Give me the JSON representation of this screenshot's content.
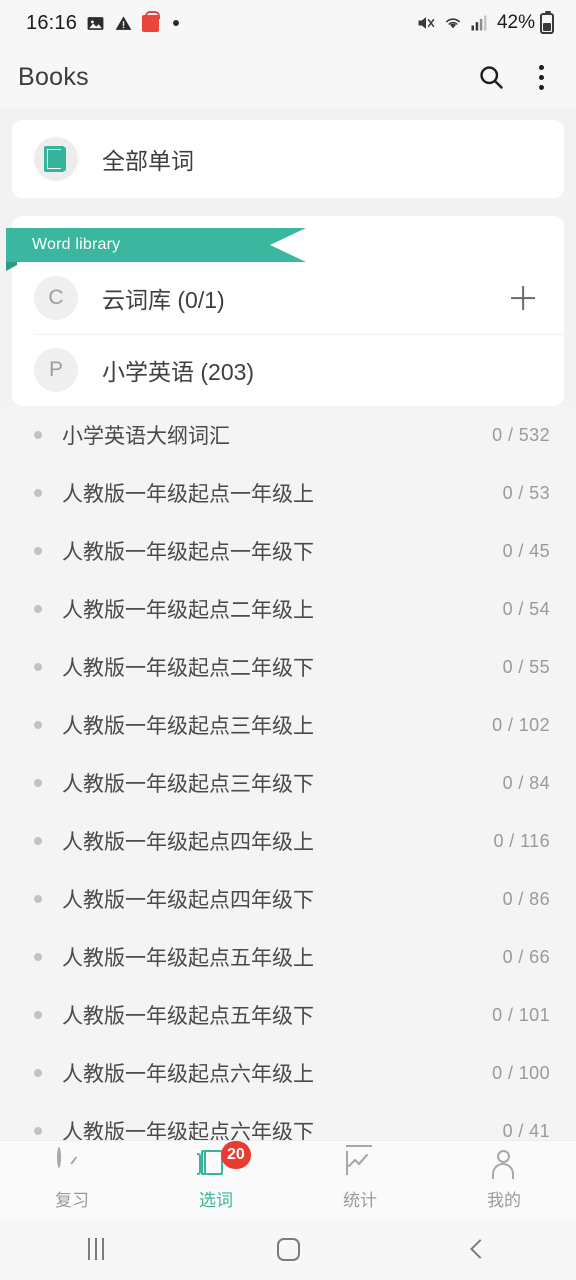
{
  "statusbar": {
    "time": "16:16",
    "battery_percent": "42%",
    "icons": [
      "image-icon",
      "warning-icon",
      "basket-icon",
      "dot-icon",
      "mute-icon",
      "wifi-icon",
      "signal-icon",
      "battery-icon"
    ]
  },
  "appbar": {
    "title": "Books",
    "search_label": "search-icon",
    "overflow_label": "more-options-icon"
  },
  "all_words_card": {
    "label": "全部单词",
    "icon": "book-icon"
  },
  "library": {
    "ribbon_label": "Word library",
    "rows": [
      {
        "initial": "C",
        "name": "云词库 (0/1)",
        "has_add": true
      },
      {
        "initial": "P",
        "name": "小学英语 (203)",
        "has_add": false
      }
    ]
  },
  "books": [
    {
      "title": "小学英语大纲词汇",
      "count": "0 / 532"
    },
    {
      "title": "人教版一年级起点一年级上",
      "count": "0 / 53"
    },
    {
      "title": "人教版一年级起点一年级下",
      "count": "0 / 45"
    },
    {
      "title": "人教版一年级起点二年级上",
      "count": "0 / 54"
    },
    {
      "title": "人教版一年级起点二年级下",
      "count": "0 / 55"
    },
    {
      "title": "人教版一年级起点三年级上",
      "count": "0 / 102"
    },
    {
      "title": "人教版一年级起点三年级下",
      "count": "0 / 84"
    },
    {
      "title": "人教版一年级起点四年级上",
      "count": "0 / 116"
    },
    {
      "title": "人教版一年级起点四年级下",
      "count": "0 / 86"
    },
    {
      "title": "人教版一年级起点五年级上",
      "count": "0 / 66"
    },
    {
      "title": "人教版一年级起点五年级下",
      "count": "0 / 101"
    },
    {
      "title": "人教版一年级起点六年级上",
      "count": "0 / 100"
    },
    {
      "title": "人教版一年级起点六年级下",
      "count": "0 / 41"
    }
  ],
  "tabs": [
    {
      "label": "复习",
      "icon": "clock-icon",
      "active": false,
      "badge": ""
    },
    {
      "label": "选词",
      "icon": "book-icon",
      "active": true,
      "badge": "20"
    },
    {
      "label": "统计",
      "icon": "chart-icon",
      "active": false,
      "badge": ""
    },
    {
      "label": "我的",
      "icon": "person-icon",
      "active": false,
      "badge": ""
    }
  ],
  "sysnav": {
    "recents": "recents-icon",
    "home": "home-icon",
    "back": "back-icon"
  },
  "colors": {
    "accent": "#35b69c",
    "ribbon": "#3ab79e",
    "badge": "#ea3b30",
    "page_bg": "#f2f2f2"
  }
}
